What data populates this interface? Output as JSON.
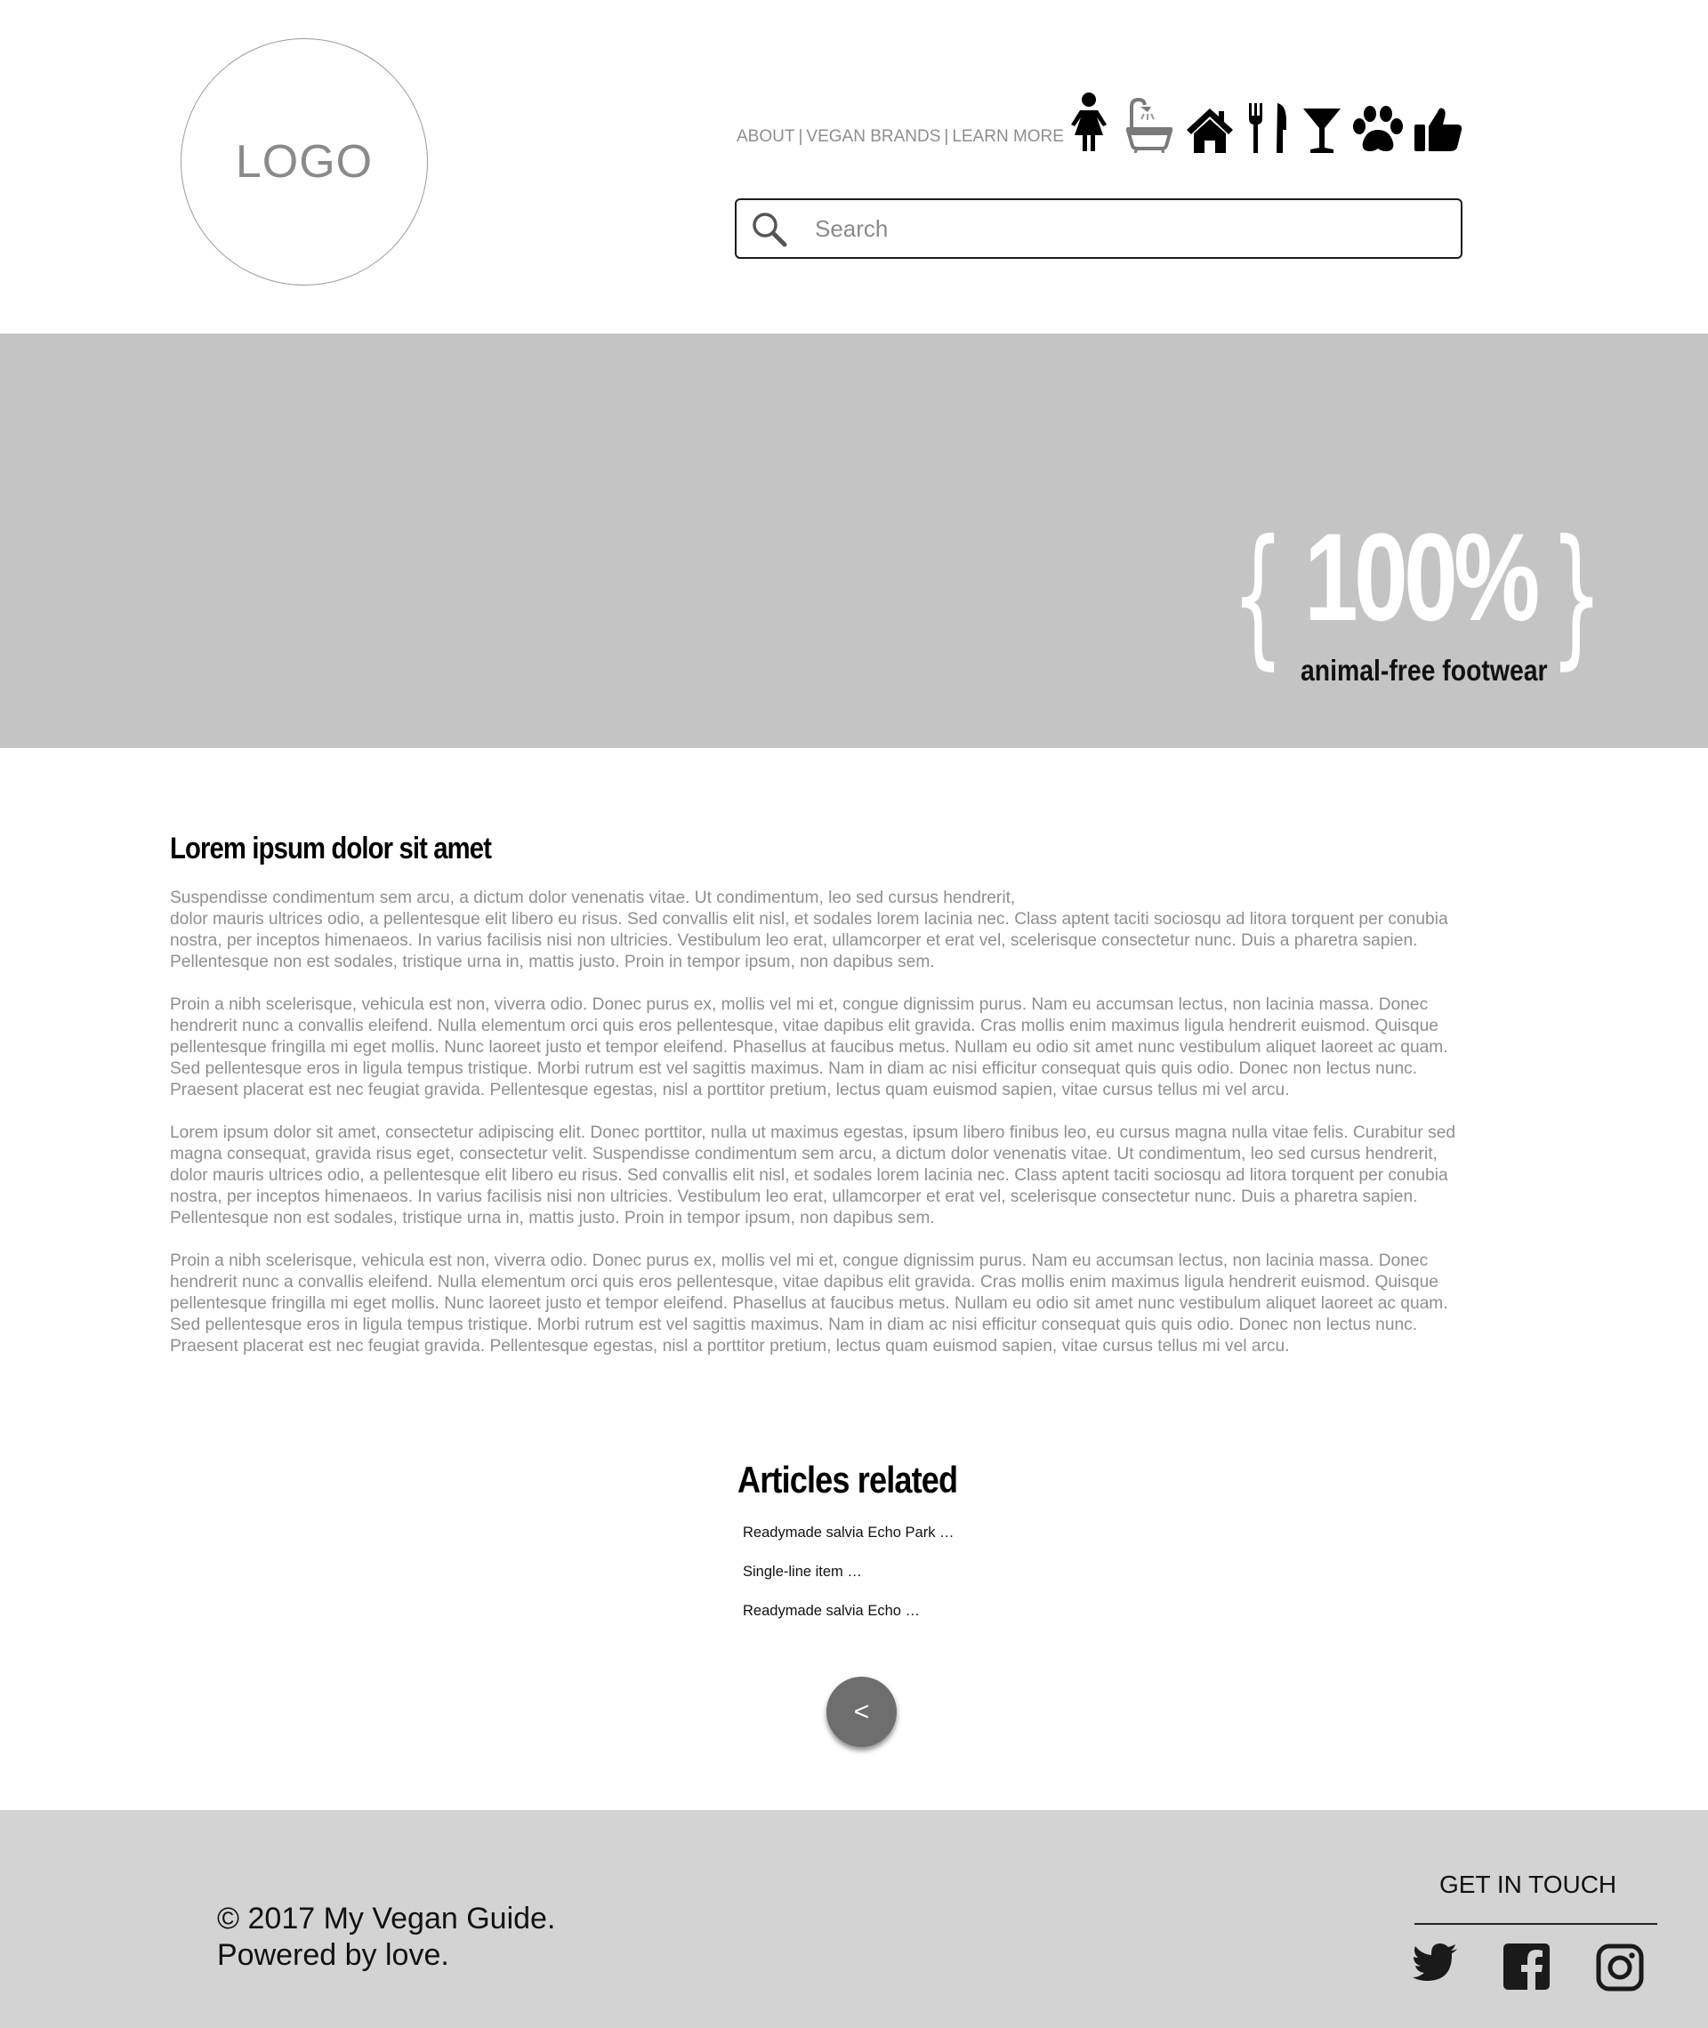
{
  "header": {
    "logo_text": "LOGO",
    "nav": [
      {
        "label": "ABOUT"
      },
      {
        "label": "VEGAN BRANDS"
      },
      {
        "label": "LEARN MORE"
      }
    ],
    "nav_separator": "|",
    "category_icons": [
      "woman-icon",
      "bathtub-icon",
      "home-icon",
      "utensils-icon",
      "cocktail-icon",
      "paw-icon",
      "thumbs-up-icon"
    ],
    "search": {
      "placeholder": "Search",
      "value": ""
    }
  },
  "banner": {
    "brace_open": "{",
    "brace_close": "}",
    "headline": "100%",
    "subline": "animal-free footwear",
    "background": "#c4c4c4"
  },
  "article": {
    "title": "Lorem ipsum dolor sit amet",
    "paragraphs": [
      "Suspendisse condimentum sem arcu, a dictum dolor venenatis vitae. Ut condimentum, leo sed cursus hendrerit,\ndolor mauris ultrices odio, a pellentesque elit libero eu risus. Sed convallis elit nisl, et sodales lorem lacinia nec. Class aptent taciti sociosqu ad litora torquent per conubia\nnostra, per inceptos himenaeos. In varius facilisis nisi non ultricies. Vestibulum leo erat, ullamcorper et erat vel, scelerisque consectetur nunc. Duis a pharetra sapien.\nPellentesque non est sodales, tristique urna in, mattis justo. Proin in tempor ipsum, non dapibus sem.",
      "Proin a nibh scelerisque, vehicula est non, viverra odio. Donec purus ex, mollis vel mi et, congue dignissim purus. Nam eu accumsan lectus, non lacinia massa. Donec\nhendrerit nunc a convallis eleifend. Nulla elementum orci quis eros pellentesque, vitae dapibus elit gravida. Cras mollis enim maximus ligula hendrerit euismod. Quisque\npellentesque fringilla mi eget mollis. Nunc laoreet justo et tempor eleifend. Phasellus at faucibus metus. Nullam eu odio sit amet nunc vestibulum aliquet laoreet ac quam.\nSed pellentesque eros in ligula tempus tristique. Morbi rutrum est vel sagittis maximus. Nam in diam ac nisi efficitur consequat quis quis odio. Donec non lectus nunc.\nPraesent placerat est nec feugiat gravida. Pellentesque egestas, nisl a porttitor pretium, lectus quam euismod sapien, vitae cursus tellus mi vel arcu.",
      "Lorem ipsum dolor sit amet, consectetur adipiscing elit. Donec porttitor, nulla ut maximus egestas, ipsum libero finibus leo, eu cursus magna nulla vitae felis. Curabitur sed\nmagna consequat, gravida risus eget, consectetur velit. Suspendisse condimentum sem arcu, a dictum dolor venenatis vitae. Ut condimentum, leo sed cursus hendrerit,\ndolor mauris ultrices odio, a pellentesque elit libero eu risus. Sed convallis elit nisl, et sodales lorem lacinia nec. Class aptent taciti sociosqu ad litora torquent per conubia\nnostra, per inceptos himenaeos. In varius facilisis nisi non ultricies. Vestibulum leo erat, ullamcorper et erat vel, scelerisque consectetur nunc. Duis a pharetra sapien.\nPellentesque non est sodales, tristique urna in, mattis justo. Proin in tempor ipsum, non dapibus sem.",
      "Proin a nibh scelerisque, vehicula est non, viverra odio. Donec purus ex, mollis vel mi et, congue dignissim purus. Nam eu accumsan lectus, non lacinia massa. Donec\nhendrerit nunc a convallis eleifend. Nulla elementum orci quis eros pellentesque, vitae dapibus elit gravida. Cras mollis enim maximus ligula hendrerit euismod. Quisque\npellentesque fringilla mi eget mollis. Nunc laoreet justo et tempor eleifend. Phasellus at faucibus metus. Nullam eu odio sit amet nunc vestibulum aliquet laoreet ac quam.\nSed pellentesque eros in ligula tempus tristique. Morbi rutrum est vel sagittis maximus. Nam in diam ac nisi efficitur consequat quis quis odio. Donec non lectus nunc.\nPraesent placerat est nec feugiat gravida. Pellentesque egestas, nisl a porttitor pretium, lectus quam euismod sapien, vitae cursus tellus mi vel arcu."
    ]
  },
  "related": {
    "title": "Articles related",
    "items": [
      {
        "label": "Readymade salvia Echo Park …"
      },
      {
        "label": "Single-line item …"
      },
      {
        "label": "Readymade salvia Echo …"
      }
    ]
  },
  "back_button": {
    "label": "<"
  },
  "footer": {
    "copyright_line1": "© 2017 My Vegan Guide.",
    "copyright_line2": "Powered by love.",
    "get_in_touch": "GET IN TOUCH",
    "social": [
      "twitter-icon",
      "facebook-icon",
      "instagram-icon"
    ],
    "background": "#d3d3d3"
  }
}
